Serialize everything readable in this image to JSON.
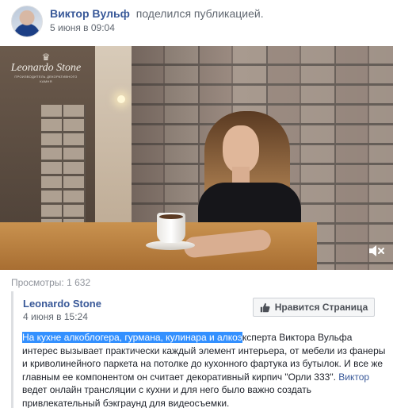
{
  "post": {
    "author": "Виктор Вульф",
    "action": "поделился публикацией.",
    "date": "5 июня в 09:04"
  },
  "video": {
    "brand": {
      "name": "Leonardo Stone",
      "tagline": "ПРОИЗВОДИТЕЛЬ ДЕКОРАТИВНОГО КАМНЯ",
      "emblem": "lion-crest-emblem"
    },
    "mute_icon": "speaker-muted-icon"
  },
  "stats": {
    "views": "Просмотры: 1 632"
  },
  "shared_post": {
    "page_name": "Leonardo Stone",
    "date": "4 июня в 15:24",
    "like_button": {
      "icon": "thumbs-up-icon",
      "label": "Нравится Страница"
    },
    "text": {
      "highlighted": "На кухне алкоблогера, гурмана, кулинара и алкоэ",
      "part1": "ксперта Виктора Вульфа интерес вызывает практически каждый элемент интерьера, от мебели из фанеры и криволинейного паркета на потолке до кухонного фартука из бутылок. И все же главным ее компонентом он считает декоративный кирпич \"Орли 333\". ",
      "link": "Виктор",
      "part2": " ведет онлайн трансляции с кухни и для него было важно создать привлекательный бэкграунд для видеосъемки."
    }
  },
  "colors": {
    "link": "#385898",
    "secondary_text": "#606770",
    "highlight": "#3390ff"
  }
}
